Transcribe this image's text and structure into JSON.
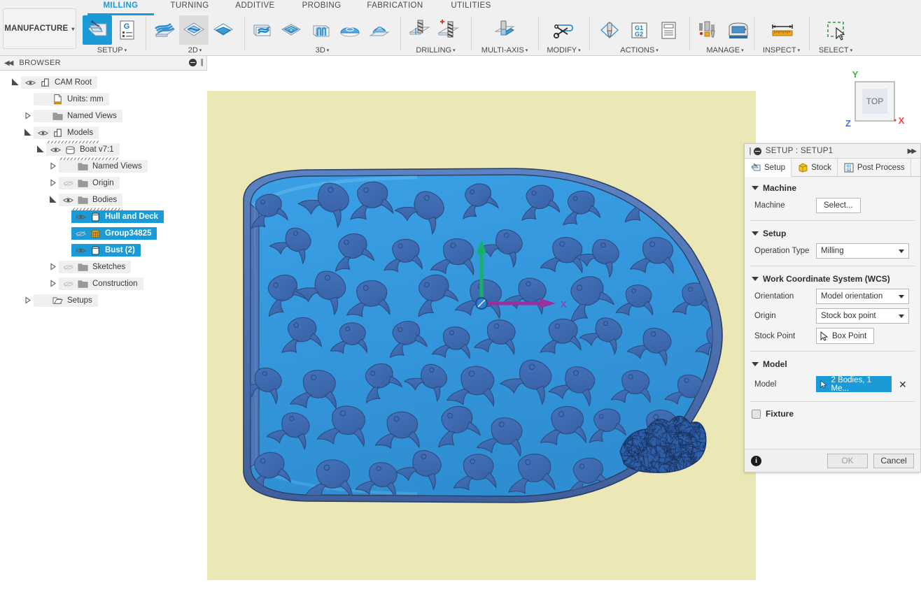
{
  "app": {
    "workspace_label": "MANUFACTURE",
    "workspace_caret": "▾"
  },
  "ribbon": {
    "tabs": [
      {
        "label": "MILLING",
        "active": true
      },
      {
        "label": "TURNING",
        "active": false
      },
      {
        "label": "ADDITIVE",
        "active": false
      },
      {
        "label": "PROBING",
        "active": false
      },
      {
        "label": "FABRICATION",
        "active": false
      },
      {
        "label": "UTILITIES",
        "active": false
      }
    ],
    "groups": [
      {
        "label": "SETUP",
        "caret": "▾"
      },
      {
        "label": "2D",
        "caret": "▾"
      },
      {
        "label": "3D",
        "caret": "▾"
      },
      {
        "label": "DRILLING",
        "caret": "▾"
      },
      {
        "label": "MULTI-AXIS",
        "caret": "▾"
      },
      {
        "label": "MODIFY",
        "caret": "▾"
      },
      {
        "label": "ACTIONS",
        "caret": "▾"
      },
      {
        "label": "MANAGE",
        "caret": "▾"
      },
      {
        "label": "INSPECT",
        "caret": "▾"
      },
      {
        "label": "SELECT",
        "caret": "▾"
      }
    ],
    "items": {
      "setup": "setup-icon",
      "gcode": "gcode-list-icon",
      "face": "face-toolpath-icon",
      "pocket2d": "2d-pocket-icon",
      "adaptive2d": "2d-adaptive-icon",
      "adaptive3d": "3d-adaptive-icon",
      "pocket3d": "3d-pocket-icon",
      "parallel3d": "3d-parallel-icon",
      "scallop3d": "3d-scallop-icon",
      "spiral3d": "3d-spiral-icon",
      "drill": "drill-icon",
      "boremulti": "bore-icon",
      "multiaxis": "multiaxis-icon",
      "modify": "scissors-icon",
      "probe": "probe-icon",
      "g1g2": "g1g2-icon",
      "setupsheet": "setup-sheet-icon",
      "toollib": "tool-library-icon",
      "machinelib": "machine-library-icon",
      "measure": "ruler-icon",
      "selectbox": "marquee-select-icon"
    }
  },
  "browser": {
    "title": "BROWSER",
    "collapse_icon": "collapse-left-icon",
    "minimize_icon": "minimize-icon",
    "tree": [
      {
        "label": "CAM Root",
        "indent": 0,
        "disclosure": "expanded",
        "eye": "visible",
        "icon": "cam-root-icon",
        "selected": false,
        "squiggle": false
      },
      {
        "label": "Units: mm",
        "indent": 1,
        "disclosure": "none",
        "eye": "none",
        "icon": "units-icon",
        "selected": false,
        "squiggle": false
      },
      {
        "label": "Named Views",
        "indent": 1,
        "disclosure": "collapsed",
        "eye": "none",
        "icon": "folder-icon",
        "selected": false,
        "squiggle": false
      },
      {
        "label": "Models",
        "indent": 1,
        "disclosure": "expanded",
        "eye": "visible",
        "icon": "models-icon",
        "selected": false,
        "squiggle": true
      },
      {
        "label": "Boat v7:1",
        "indent": 2,
        "disclosure": "expanded",
        "eye": "visible",
        "icon": "component-icon",
        "selected": false,
        "squiggle": true
      },
      {
        "label": "Named Views",
        "indent": 3,
        "disclosure": "collapsed",
        "eye": "none",
        "icon": "folder-icon",
        "selected": false,
        "squiggle": false
      },
      {
        "label": "Origin",
        "indent": 3,
        "disclosure": "collapsed",
        "eye": "hidden",
        "icon": "folder-icon",
        "selected": false,
        "squiggle": false
      },
      {
        "label": "Bodies",
        "indent": 3,
        "disclosure": "expanded",
        "eye": "visible",
        "icon": "folder-icon",
        "selected": false,
        "squiggle": true
      },
      {
        "label": "Hull and Deck",
        "indent": 4,
        "disclosure": "none",
        "eye": "visible",
        "icon": "body-icon",
        "selected": true,
        "squiggle": false
      },
      {
        "label": "Group34825",
        "indent": 4,
        "disclosure": "none",
        "eye": "hidden",
        "icon": "mesh-body-icon",
        "selected": true,
        "squiggle": false
      },
      {
        "label": "Bust (2)",
        "indent": 4,
        "disclosure": "none",
        "eye": "visible",
        "icon": "body-icon",
        "selected": true,
        "squiggle": false
      },
      {
        "label": "Sketches",
        "indent": 3,
        "disclosure": "collapsed",
        "eye": "hidden",
        "icon": "folder-icon",
        "selected": false,
        "squiggle": false
      },
      {
        "label": "Construction",
        "indent": 3,
        "disclosure": "collapsed",
        "eye": "hidden",
        "icon": "folder-icon",
        "selected": false,
        "squiggle": false
      },
      {
        "label": "Setups",
        "indent": 1,
        "disclosure": "collapsed",
        "eye": "none",
        "icon": "setups-folder-icon",
        "selected": false,
        "squiggle": false
      }
    ]
  },
  "canvas": {
    "background_color": "#ece8b6",
    "viewcube": {
      "face_label": "TOP",
      "axis_y": "Y",
      "axis_x": "X",
      "axis_z": "Z",
      "color_y": "#3db33d",
      "color_x": "#e8474a",
      "color_z": "#4a6fd0"
    },
    "model": {
      "hull_fill": "#3399e0",
      "hull_rim": "#4a6fb5",
      "fish_fill": "#3f6cb5",
      "mesh_fill": "#2e5ea8",
      "wcs_x_color": "#9b2fa0",
      "wcs_y_color": "#17b06b"
    }
  },
  "setup_panel": {
    "header_title": "SETUP : SETUP1",
    "collapse_icon": "minimize-icon",
    "expand_icon": "expand-right-icon",
    "tabs": [
      {
        "label": "Setup",
        "icon": "setup-tab-icon",
        "active": true
      },
      {
        "label": "Stock",
        "icon": "stock-cube-icon",
        "active": false
      },
      {
        "label": "Post Process",
        "icon": "g1g2-icon",
        "active": false
      }
    ],
    "sections": {
      "machine": {
        "title": "Machine",
        "machine_label": "Machine",
        "machine_button": "Select..."
      },
      "setup": {
        "title": "Setup",
        "operation_type_label": "Operation Type",
        "operation_type_value": "Milling"
      },
      "wcs": {
        "title": "Work Coordinate System (WCS)",
        "orientation_label": "Orientation",
        "orientation_value": "Model orientation",
        "origin_label": "Origin",
        "origin_value": "Stock box point",
        "stock_point_label": "Stock Point",
        "stock_point_value": "Box Point"
      },
      "model": {
        "title": "Model",
        "model_label": "Model",
        "model_value": "2 Bodies, 1 Me...",
        "clear_icon": "clear-selection-icon"
      },
      "fixture": {
        "label": "Fixture",
        "checked": false
      }
    },
    "footer": {
      "info_icon": "info-icon",
      "ok_label": "OK",
      "cancel_label": "Cancel"
    }
  }
}
